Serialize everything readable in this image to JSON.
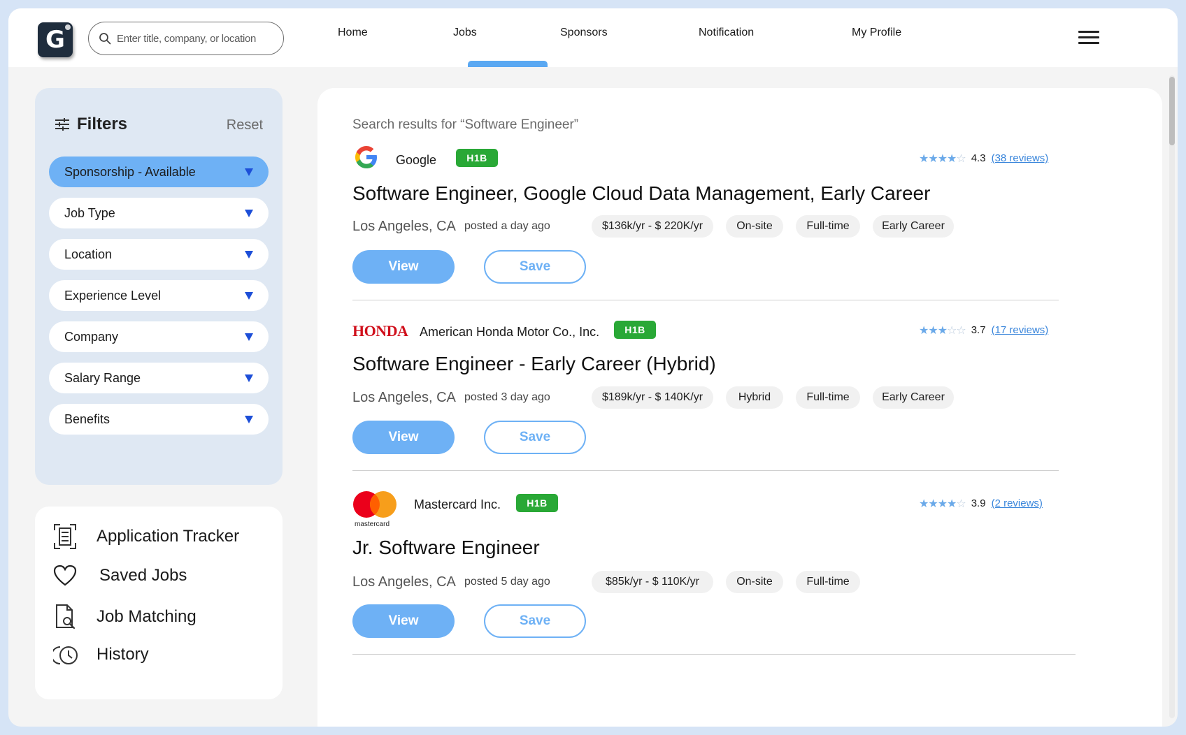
{
  "nav": {
    "search_placeholder": "Enter title, company, or location",
    "items": [
      "Home",
      "Jobs",
      "Sponsors",
      "Notification",
      "My Profile"
    ],
    "active": "Jobs"
  },
  "filters": {
    "title": "Filters",
    "reset": "Reset",
    "dropdowns": [
      "Sponsorship - Available",
      "Job Type",
      "Location",
      "Experience Level",
      "Company",
      "Salary Range",
      "Benefits"
    ]
  },
  "links": [
    "Application Tracker",
    "Saved Jobs",
    "Job Matching",
    "History"
  ],
  "results": {
    "title": "Search results for “Software Engineer”",
    "jobs": [
      {
        "company": "Google",
        "badge": "H1B",
        "rating": "4.3",
        "stars": 4,
        "reviews": "(38 reviews)",
        "title": "Software Engineer, Google Cloud Data Management, Early Career",
        "location": "Los Angeles, CA",
        "posted": "posted a day ago",
        "tags": [
          "$136k/yr - $ 220K/yr",
          "On-site",
          "Full-time",
          "Early Career"
        ],
        "view": "View",
        "save": "Save"
      },
      {
        "company": "American Honda Motor Co., Inc.",
        "logo_text": "HONDA",
        "badge": "H1B",
        "rating": "3.7",
        "stars": 3,
        "reviews": "(17 reviews)",
        "title": "Software Engineer - Early Career (Hybrid)",
        "location": "Los Angeles, CA",
        "posted": "posted 3 day ago",
        "tags": [
          "$189k/yr - $ 140K/yr",
          "Hybrid",
          "Full-time",
          "Early Career"
        ],
        "view": "View",
        "save": "Save"
      },
      {
        "company": "Mastercard Inc.",
        "logo_text": "mastercard",
        "badge": "H1B",
        "rating": "3.9",
        "stars": 4,
        "reviews": "(2 reviews)",
        "title": "Jr. Software Engineer",
        "location": "Los Angeles, CA",
        "posted": "posted 5 day ago",
        "tags": [
          "$85k/yr - $ 110K/yr",
          "On-site",
          "Full-time"
        ],
        "view": "View",
        "save": "Save"
      }
    ]
  },
  "colors": {
    "accent": "#6eb1f5",
    "badge": "#29a836",
    "page_bg": "#f4f4f4",
    "filter_bg": "#dfe8f3"
  },
  "icons": [
    "search-icon",
    "filter-icon",
    "chevron-down-icon",
    "menu-icon",
    "tracker-icon",
    "heart-icon",
    "job-search-icon",
    "history-icon",
    "star-icon"
  ]
}
